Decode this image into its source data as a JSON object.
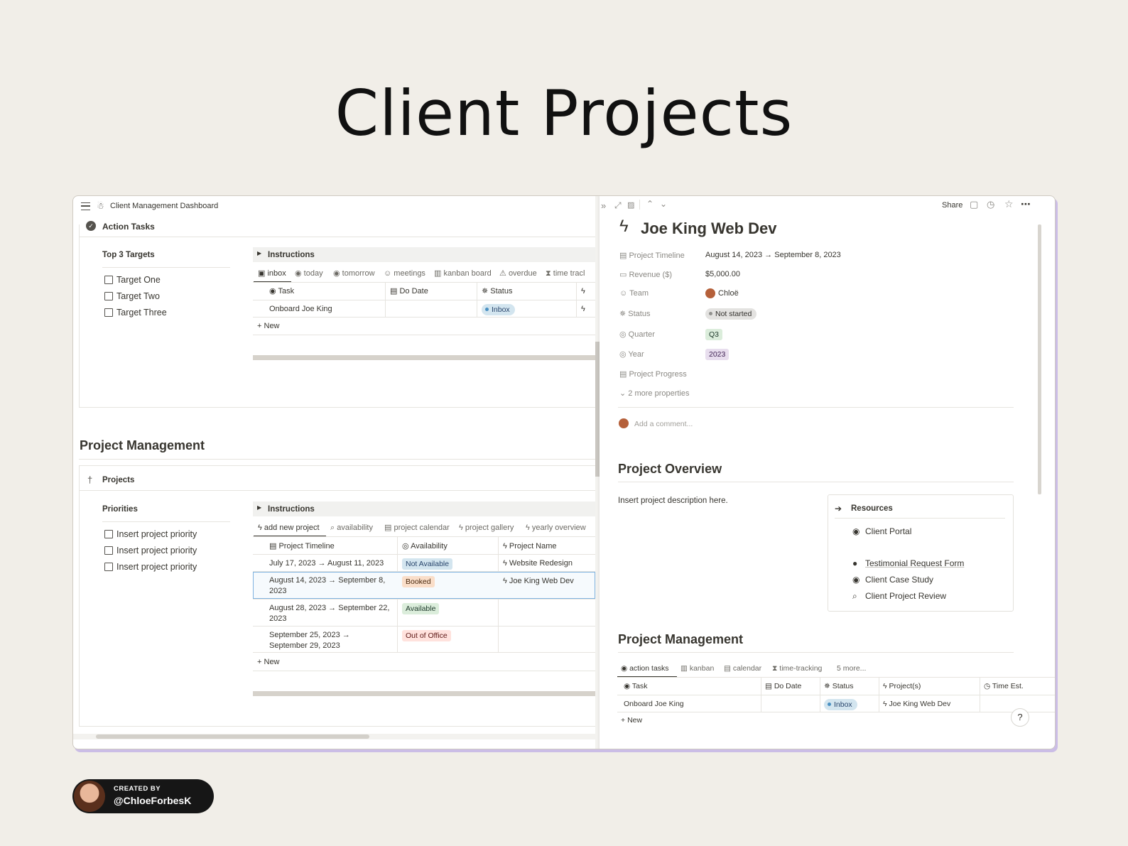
{
  "page_title": "Client Projects",
  "left": {
    "breadcrumb": "Client Management Dashboard",
    "action_tasks": {
      "title": "Action Tasks",
      "targets_header": "Top 3 Targets",
      "targets": [
        "Target One",
        "Target Two",
        "Target Three"
      ],
      "instructions": "Instructions",
      "tabs": [
        "inbox",
        "today",
        "tomorrow",
        "meetings",
        "kanban board",
        "overdue",
        "time tracl"
      ],
      "columns": [
        "Task",
        "Do Date",
        "Status"
      ],
      "row": {
        "task": "Onboard Joe King",
        "status": "Inbox"
      },
      "new_label": "New"
    },
    "project_management": {
      "heading": "Project Management",
      "projects_title": "Projects",
      "priorities_header": "Priorities",
      "priorities": [
        "Insert project priority",
        "Insert project priority",
        "Insert project priority"
      ],
      "instructions": "Instructions",
      "tabs": [
        "add new project",
        "availability",
        "project calendar",
        "project gallery",
        "yearly overview"
      ],
      "columns": [
        "Project Timeline",
        "Availability",
        "Project Name"
      ],
      "rows": [
        {
          "timeline": "July 17, 2023 → August 11, 2023",
          "availability": "Not Available",
          "name": "Website Redesign"
        },
        {
          "timeline": "August 14, 2023 → September 8, 2023",
          "availability": "Booked",
          "name": "Joe King Web Dev"
        },
        {
          "timeline": "August 28, 2023 → September 22, 2023",
          "availability": "Available",
          "name": ""
        },
        {
          "timeline": "September 25, 2023 → September 29, 2023",
          "availability": "Out of Office",
          "name": ""
        }
      ],
      "new_label": "New"
    }
  },
  "right": {
    "toolbar": {
      "share": "Share"
    },
    "title": "Joe King Web Dev",
    "properties": [
      {
        "label": "Project Timeline",
        "value": "August 14, 2023 → September 8, 2023"
      },
      {
        "label": "Revenue ($)",
        "value": "$5,000.00"
      },
      {
        "label": "Team",
        "value": "Chloë"
      },
      {
        "label": "Status",
        "value": "Not started"
      },
      {
        "label": "Quarter",
        "value": "Q3"
      },
      {
        "label": "Year",
        "value": "2023"
      },
      {
        "label": "Project Progress",
        "value": ""
      }
    ],
    "more_properties": "2 more properties",
    "comment_placeholder": "Add a comment...",
    "overview_heading": "Project Overview",
    "overview_text": "Insert project description here.",
    "resources": {
      "title": "Resources",
      "links": [
        "Client Portal",
        "Testimonial Request Form",
        "Client Case Study",
        "Client Project Review"
      ]
    },
    "pm_heading": "Project Management",
    "pm_tabs": [
      "action tasks",
      "kanban",
      "calendar",
      "time-tracking",
      "5 more..."
    ],
    "pm_columns": [
      "Task",
      "Do Date",
      "Status",
      "Project(s)",
      "Time Est."
    ],
    "pm_row": {
      "task": "Onboard Joe King",
      "status": "Inbox",
      "project": "Joe King Web Dev"
    },
    "new_label": "New",
    "help": "?"
  },
  "badge": {
    "created_by": "CREATED BY",
    "handle": "@ChloeForbesK"
  }
}
